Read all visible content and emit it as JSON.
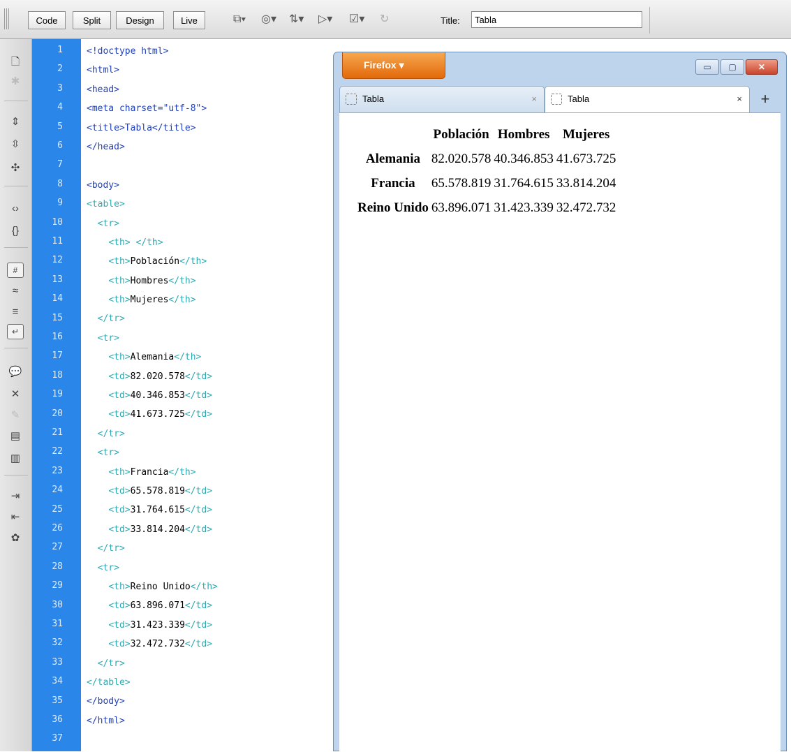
{
  "toolbar": {
    "view_buttons": [
      "Code",
      "Split",
      "Design",
      "Live"
    ],
    "title_label": "Title:",
    "title_value": "Tabla",
    "icons": [
      "multiscreen-icon",
      "preview-browser-icon",
      "file-management-icon",
      "check-page-icon",
      "validate-icon",
      "refresh-icon"
    ]
  },
  "left_strip": {
    "icons": [
      "open-documents-icon",
      "show-code-navigator-icon",
      "collapse-full-tag-icon",
      "collapse-selection-icon",
      "expand-all-icon",
      "select-parent-tag-icon",
      "balance-braces-icon",
      "line-numbers-icon",
      "highlight-invalid-code-icon",
      "syntax-coloring-icon",
      "word-wrap-icon",
      "apply-comment-icon",
      "remove-comment-icon",
      "wrap-tag-icon",
      "recent-snippets-icon",
      "move-css-icon",
      "indent-code-icon",
      "outdent-code-icon",
      "format-source-icon"
    ]
  },
  "code_lines": [
    "<!doctype html>",
    "<html>",
    "<head>",
    "<meta charset=\"utf-8\">",
    "<title>Tabla</title>",
    "</head>",
    "",
    "<body>",
    "<table>",
    "  <tr>",
    "    <th> </th>",
    "    <th>Población</th>",
    "    <th>Hombres</th>",
    "    <th>Mujeres</th>",
    "  </tr>",
    "  <tr>",
    "    <th>Alemania</th>",
    "    <td>82.020.578</td>",
    "    <td>40.346.853</td>",
    "    <td>41.673.725</td>",
    "  </tr>",
    "  <tr>",
    "    <th>Francia</th>",
    "    <td>65.578.819</td>",
    "    <td>31.764.615</td>",
    "    <td>33.814.204</td>",
    "  </tr>",
    "  <tr>",
    "    <th>Reino Unido</th>",
    "    <td>63.896.071</td>",
    "    <td>31.423.339</td>",
    "    <td>32.472.732</td>",
    "  </tr>",
    "</table>",
    "</body>",
    "</html>",
    ""
  ],
  "firefox": {
    "menu_label": "Firefox",
    "tabs": [
      {
        "title": "Tabla",
        "close": "×"
      },
      {
        "title": "Tabla",
        "close": "×"
      }
    ],
    "new_tab": "+",
    "window_controls": {
      "minimize": "▭",
      "maximize": "▢",
      "close": "✕"
    },
    "table": {
      "headers": [
        "",
        "Población",
        "Hombres",
        "Mujeres"
      ],
      "rows": [
        {
          "label": "Alemania",
          "values": [
            "82.020.578",
            "40.346.853",
            "41.673.725"
          ]
        },
        {
          "label": "Francia",
          "values": [
            "65.578.819",
            "31.764.615",
            "33.814.204"
          ]
        },
        {
          "label": "Reino Unido",
          "values": [
            "63.896.071",
            "31.423.339",
            "32.472.732"
          ]
        }
      ]
    }
  },
  "colors": {
    "gutter": "#2b86e9",
    "tag": "#1f3fb8",
    "table_tag": "#2caab2",
    "firefox_orange": "#e2690a"
  }
}
